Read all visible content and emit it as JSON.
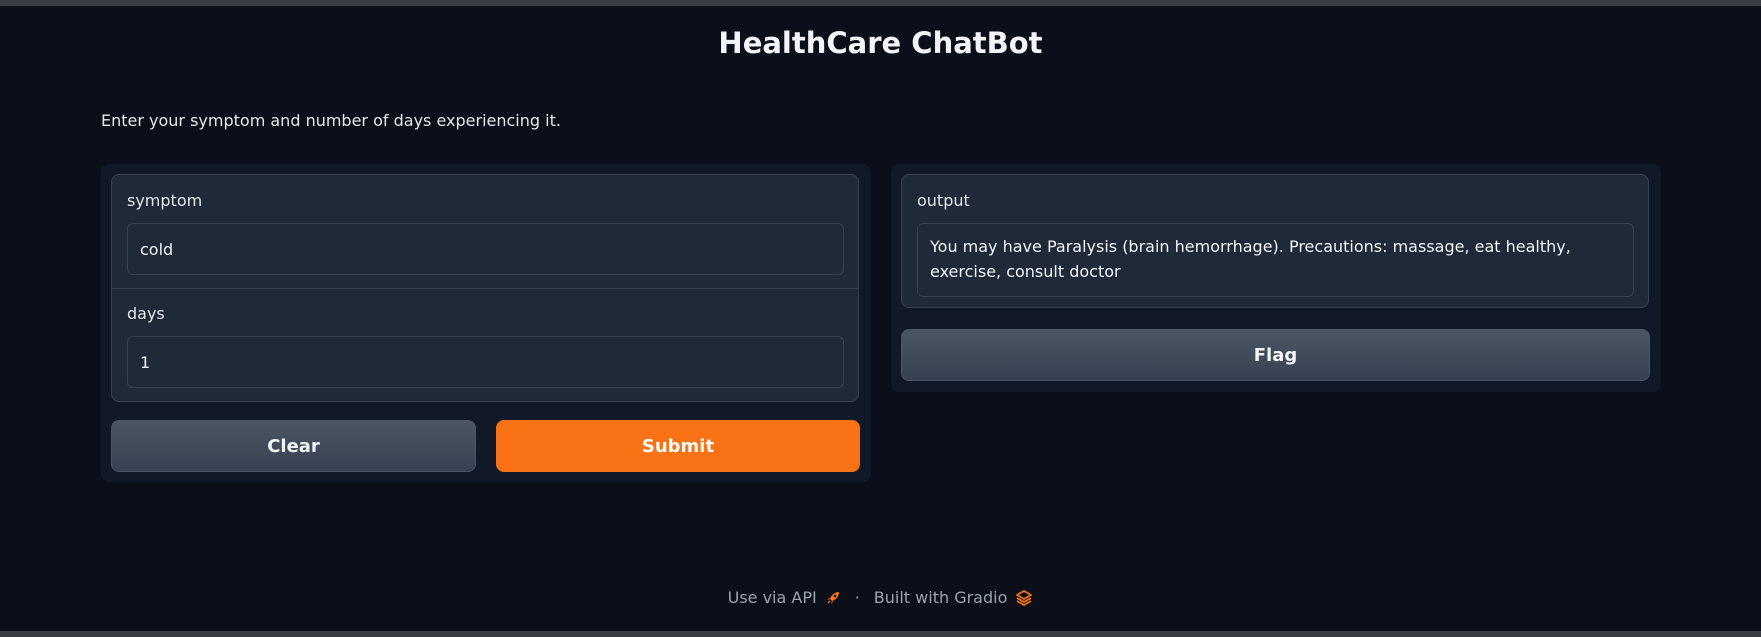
{
  "header": {
    "title": "HealthCare ChatBot",
    "description": "Enter your symptom and number of days experiencing it."
  },
  "inputs": {
    "symptom_label": "symptom",
    "symptom_value": "cold",
    "days_label": "days",
    "days_value": "1"
  },
  "buttons": {
    "clear": "Clear",
    "submit": "Submit",
    "flag": "Flag"
  },
  "output": {
    "label": "output",
    "value": "You may have Paralysis (brain hemorrhage). Precautions: massage, eat healthy, exercise, consult doctor"
  },
  "footer": {
    "api_link": "Use via API",
    "separator": "·",
    "built_with": "Built with Gradio"
  },
  "icons": {
    "api": "rocket-icon",
    "gradio": "gradio-logo-icon"
  },
  "colors": {
    "background": "#0b0f19",
    "panel": "#111827",
    "block": "#1f2937",
    "border": "#374151",
    "primary": "#f97316"
  }
}
